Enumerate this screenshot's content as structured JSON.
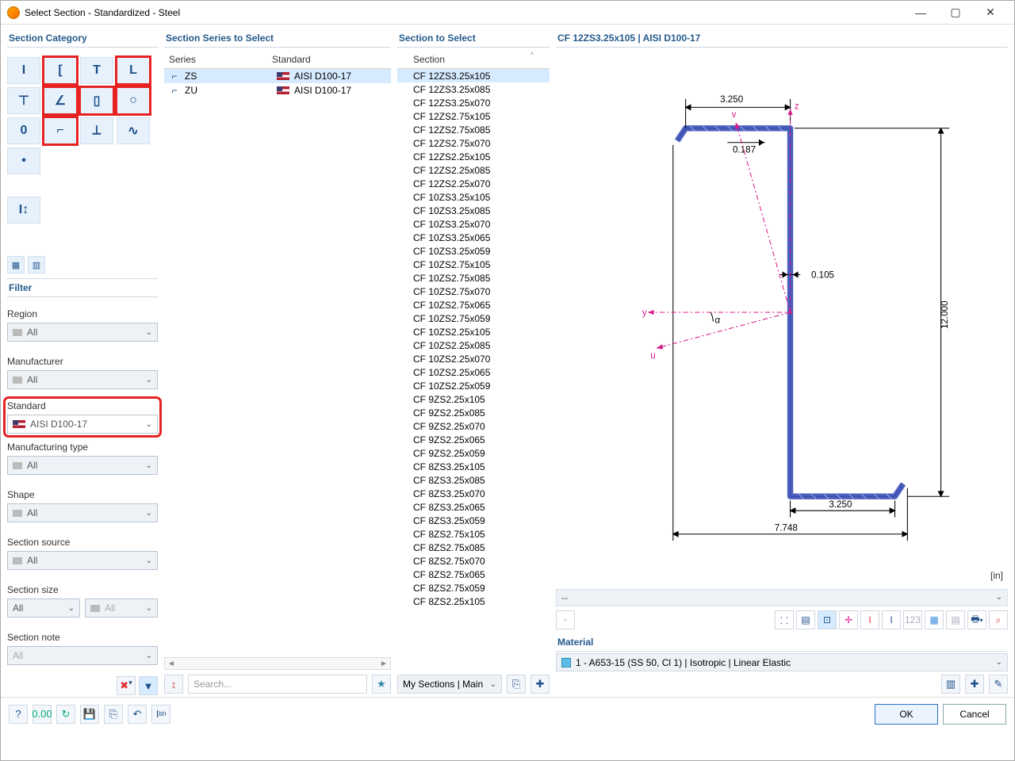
{
  "window": {
    "title": "Select Section - Standardized - Steel"
  },
  "panels": {
    "category": "Section Category",
    "series": "Section Series to Select",
    "section": "Section to Select",
    "filter": "Filter",
    "material": "Material"
  },
  "series_table": {
    "headers": {
      "series": "Series",
      "standard": "Standard"
    },
    "rows": [
      {
        "series": "ZS",
        "standard": "AISI D100-17",
        "selected": true
      },
      {
        "series": "ZU",
        "standard": "AISI D100-17",
        "selected": false
      }
    ]
  },
  "section_table": {
    "header": "Section",
    "rows": [
      "CF 12ZS3.25x105",
      "CF 12ZS3.25x085",
      "CF 12ZS3.25x070",
      "CF 12ZS2.75x105",
      "CF 12ZS2.75x085",
      "CF 12ZS2.75x070",
      "CF 12ZS2.25x105",
      "CF 12ZS2.25x085",
      "CF 12ZS2.25x070",
      "CF 10ZS3.25x105",
      "CF 10ZS3.25x085",
      "CF 10ZS3.25x070",
      "CF 10ZS3.25x065",
      "CF 10ZS3.25x059",
      "CF 10ZS2.75x105",
      "CF 10ZS2.75x085",
      "CF 10ZS2.75x070",
      "CF 10ZS2.75x065",
      "CF 10ZS2.75x059",
      "CF 10ZS2.25x105",
      "CF 10ZS2.25x085",
      "CF 10ZS2.25x070",
      "CF 10ZS2.25x065",
      "CF 10ZS2.25x059",
      "CF 9ZS2.25x105",
      "CF 9ZS2.25x085",
      "CF 9ZS2.25x070",
      "CF 9ZS2.25x065",
      "CF 9ZS2.25x059",
      "CF 8ZS3.25x105",
      "CF 8ZS3.25x085",
      "CF 8ZS3.25x070",
      "CF 8ZS3.25x065",
      "CF 8ZS3.25x059",
      "CF 8ZS2.75x105",
      "CF 8ZS2.75x085",
      "CF 8ZS2.75x070",
      "CF 8ZS2.75x065",
      "CF 8ZS2.75x059",
      "CF 8ZS2.25x105"
    ],
    "selected_index": 0
  },
  "filter": {
    "region_label": "Region",
    "region_value": "All",
    "manufacturer_label": "Manufacturer",
    "manufacturer_value": "All",
    "standard_label": "Standard",
    "standard_value": "AISI D100-17",
    "mfg_type_label": "Manufacturing type",
    "mfg_type_value": "All",
    "shape_label": "Shape",
    "shape_value": "All",
    "source_label": "Section source",
    "source_value": "All",
    "size_label": "Section size",
    "size_value_a": "All",
    "size_value_b": "All",
    "note_label": "Section note",
    "note_value": "All"
  },
  "search": {
    "placeholder": "Search..."
  },
  "mysections": {
    "label": "My Sections | Main"
  },
  "preview": {
    "title": "CF 12ZS3.25x105 | AISI D100-17",
    "dims": {
      "top_flange": "3.250",
      "lip": "0.187",
      "thickness": "0.105",
      "height": "12.000",
      "bottom_flange": "3.250",
      "overall": "7.748",
      "alpha": "α",
      "y": "y",
      "z": "z",
      "u": "u",
      "v": "v"
    },
    "unit": "[in]",
    "status": "--"
  },
  "material": {
    "value": "1 - A653-15 (SS 50, Cl 1) | Isotropic | Linear Elastic"
  },
  "buttons": {
    "ok": "OK",
    "cancel": "Cancel"
  },
  "category_icons": [
    "I",
    "[",
    "T",
    "L",
    "⊤",
    "∠",
    "▯",
    "○",
    "0",
    "⌐",
    "⟂",
    "∿",
    "•",
    "",
    "",
    "⇵"
  ]
}
